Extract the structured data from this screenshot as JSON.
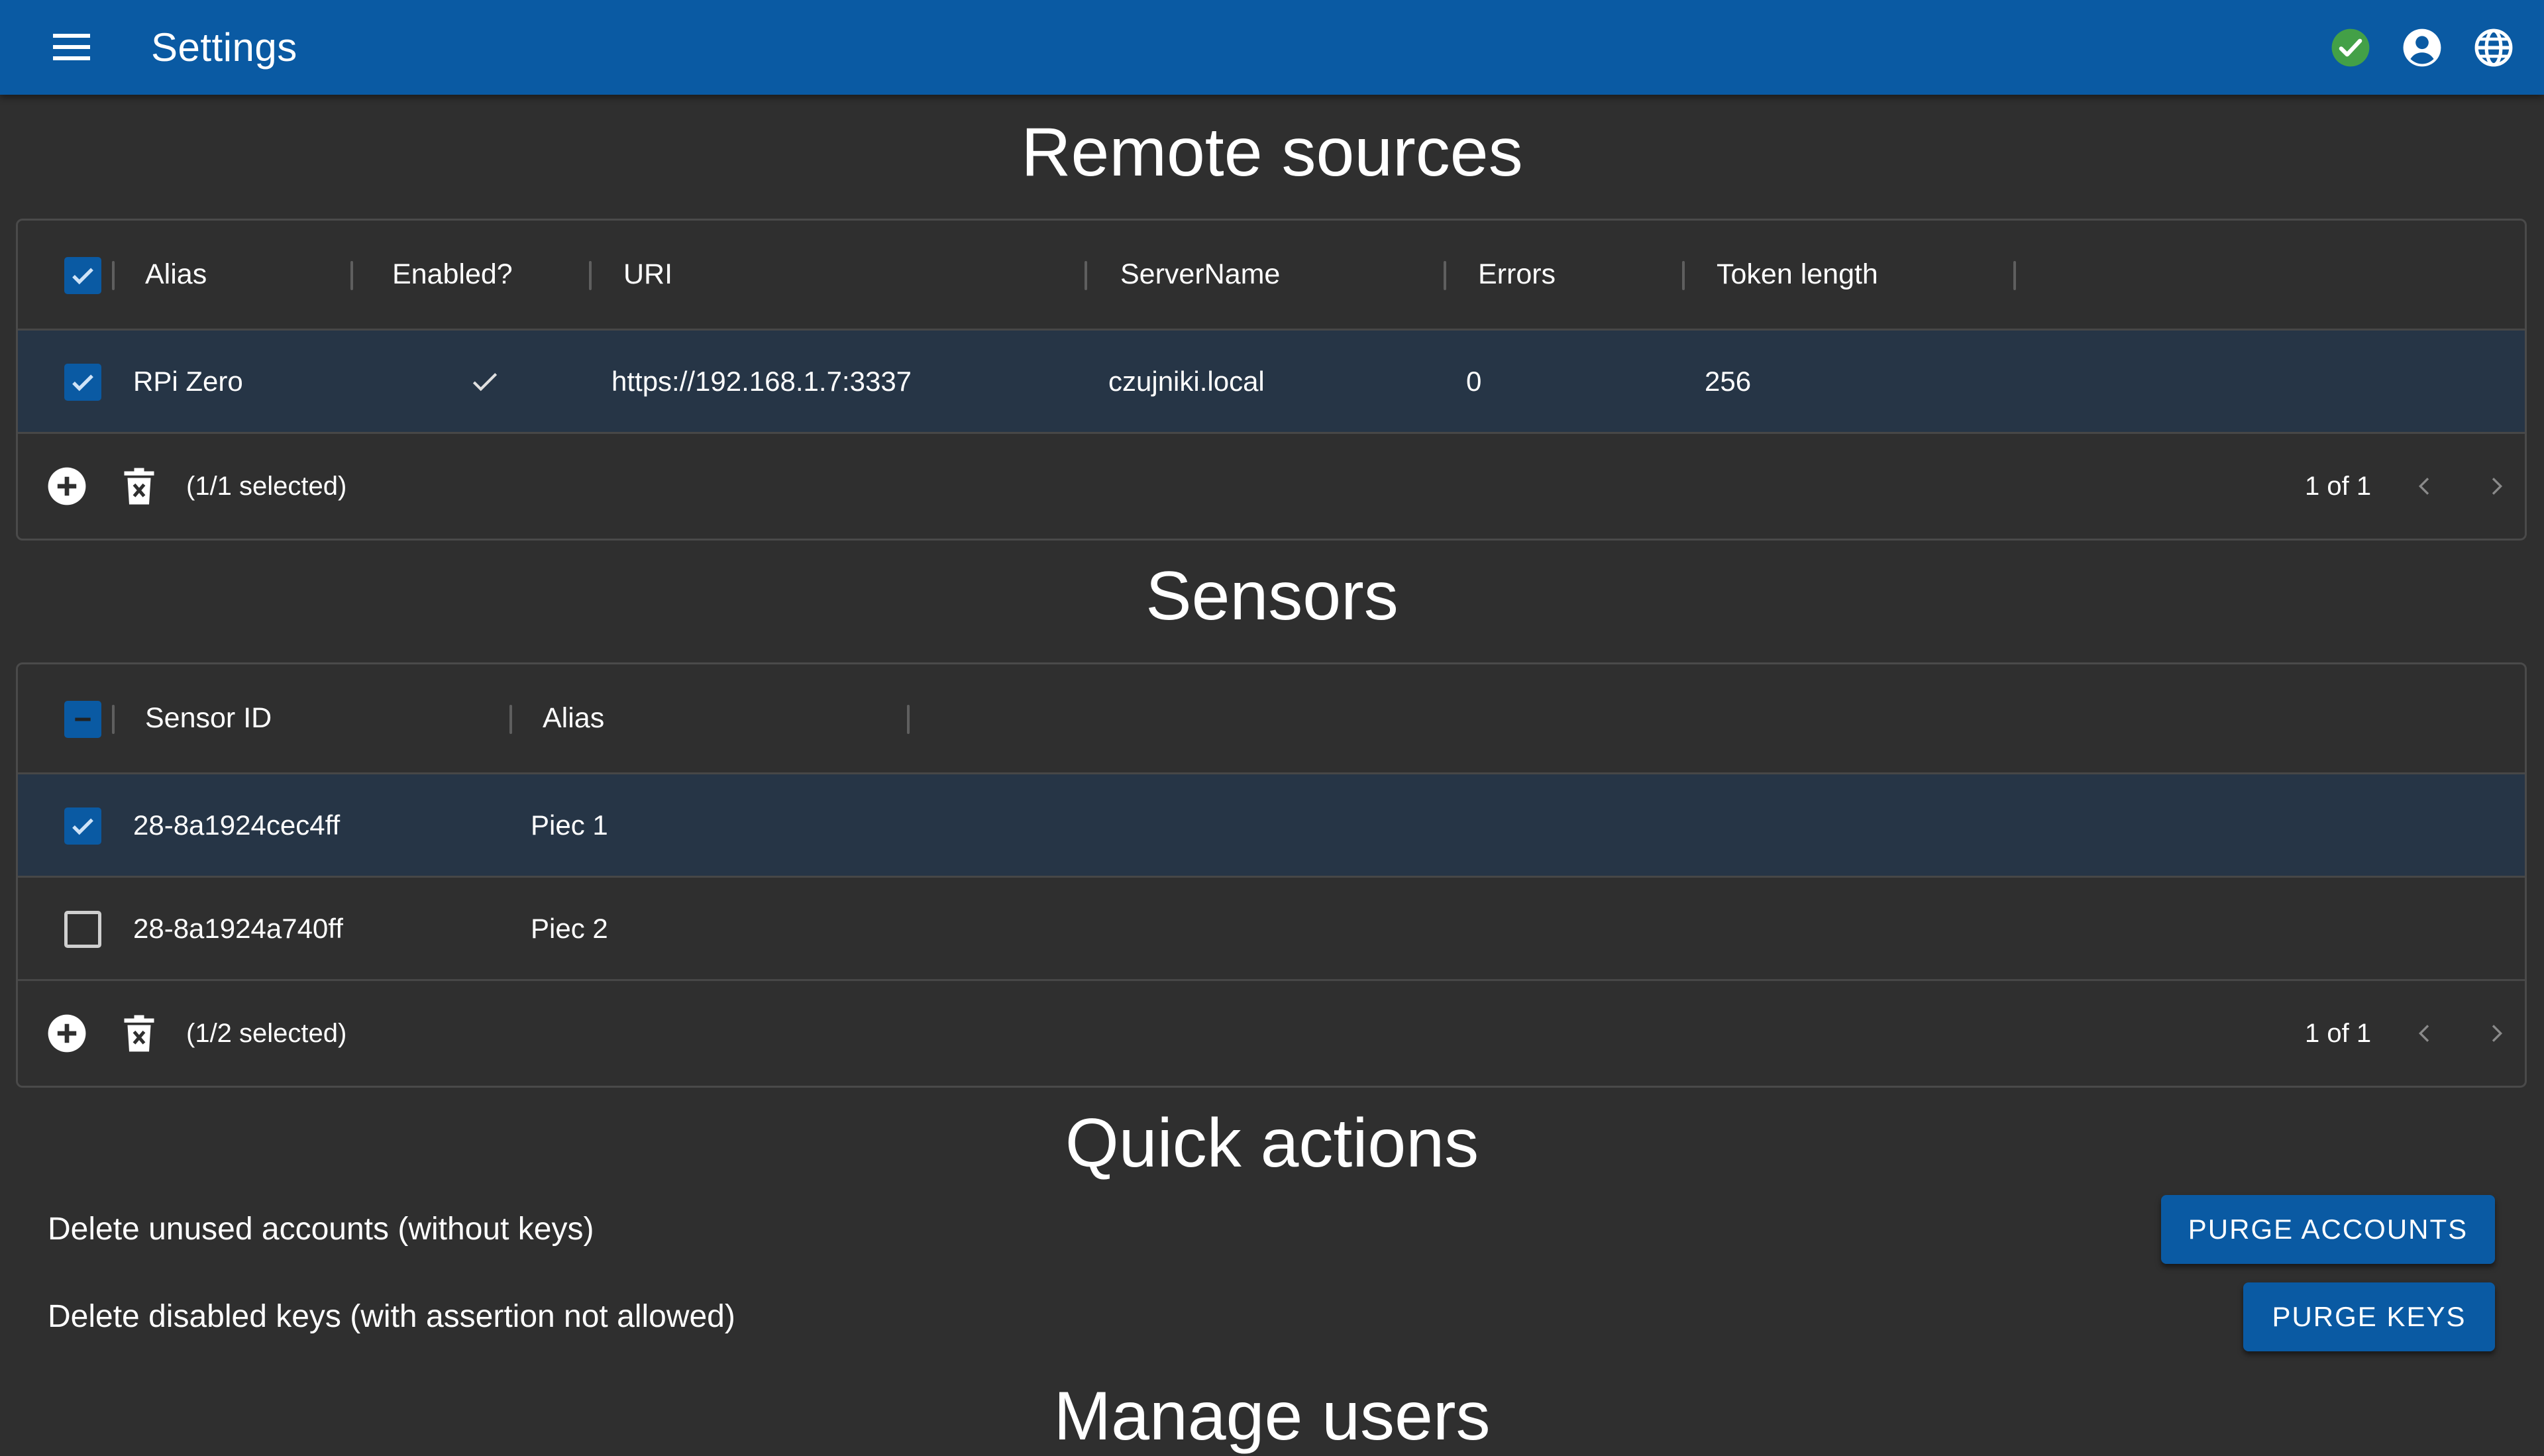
{
  "appbar": {
    "title": "Settings",
    "icons": {
      "menu": "menu-icon",
      "status": "check-circle-icon",
      "account": "account-circle-icon",
      "language": "globe-icon"
    },
    "colors": {
      "primary": "#0a5aa3",
      "status_ok": "#43a047"
    }
  },
  "remote_sources": {
    "title": "Remote sources",
    "columns": [
      "Alias",
      "Enabled?",
      "URI",
      "ServerName",
      "Errors",
      "Token length"
    ],
    "rows": [
      {
        "selected": true,
        "alias": "RPi Zero",
        "enabled": true,
        "uri": "https://192.168.1.7:3337",
        "server_name": "czujniki.local",
        "errors": "0",
        "token_length": "256"
      }
    ],
    "footer": {
      "selection": "(1/1 selected)",
      "pager": "1 of 1"
    }
  },
  "sensors": {
    "title": "Sensors",
    "columns": [
      "Sensor ID",
      "Alias"
    ],
    "rows": [
      {
        "selected": true,
        "sensor_id": "28-8a1924cec4ff",
        "alias": "Piec 1"
      },
      {
        "selected": false,
        "sensor_id": "28-8a1924a740ff",
        "alias": "Piec 2"
      }
    ],
    "footer": {
      "selection": "(1/2 selected)",
      "pager": "1 of 1"
    }
  },
  "quick_actions": {
    "title": "Quick actions",
    "items": [
      {
        "label": "Delete unused accounts (without keys)",
        "button": "PURGE ACCOUNTS"
      },
      {
        "label": "Delete disabled keys (with assertion not allowed)",
        "button": "PURGE KEYS"
      }
    ]
  },
  "manage_users": {
    "title": "Manage users"
  }
}
